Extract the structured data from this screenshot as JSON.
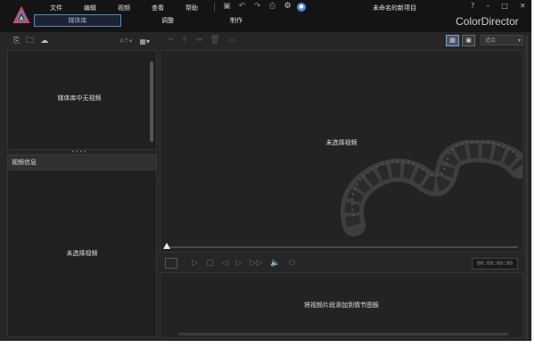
{
  "menu": [
    "文件",
    "编辑",
    "视频",
    "查看",
    "帮助"
  ],
  "tabs": [
    "媒体库",
    "调整",
    "制作"
  ],
  "project_title": "未命名的新项目",
  "window_controls": [
    "?",
    "–",
    "□",
    "✕"
  ],
  "brand": "ColorDirector",
  "library": {
    "empty_text": "媒体库中无视频",
    "sort_label": "A↑▾"
  },
  "info": {
    "header": "视频信息",
    "empty_text": "未选择视频"
  },
  "preview": {
    "empty_text": "未选择视频",
    "fit_label": "适合",
    "timecode": "00:00:00:00"
  },
  "storyboard": {
    "empty_text": "将视频片段添加到情节图板"
  },
  "icons": {
    "title_tools": [
      "save-icon",
      "undo-icon",
      "redo-icon",
      "export-icon",
      "settings-icon",
      "notification-icon"
    ],
    "library_tools": [
      "import-media-icon",
      "import-folder-icon",
      "cloud-icon",
      "view-grid-icon"
    ],
    "preview_tools": [
      "cut-icon",
      "split-icon",
      "trim-icon",
      "delete-icon",
      "caption-icon"
    ],
    "playback": [
      "play-icon",
      "stop-icon",
      "prev-frame-icon",
      "next-frame-icon",
      "fast-forward-icon",
      "volume-icon",
      "snapshot-icon"
    ]
  },
  "colors": {
    "accent": "#4a8de8",
    "background": "#262626",
    "titlebar": "#141414"
  }
}
